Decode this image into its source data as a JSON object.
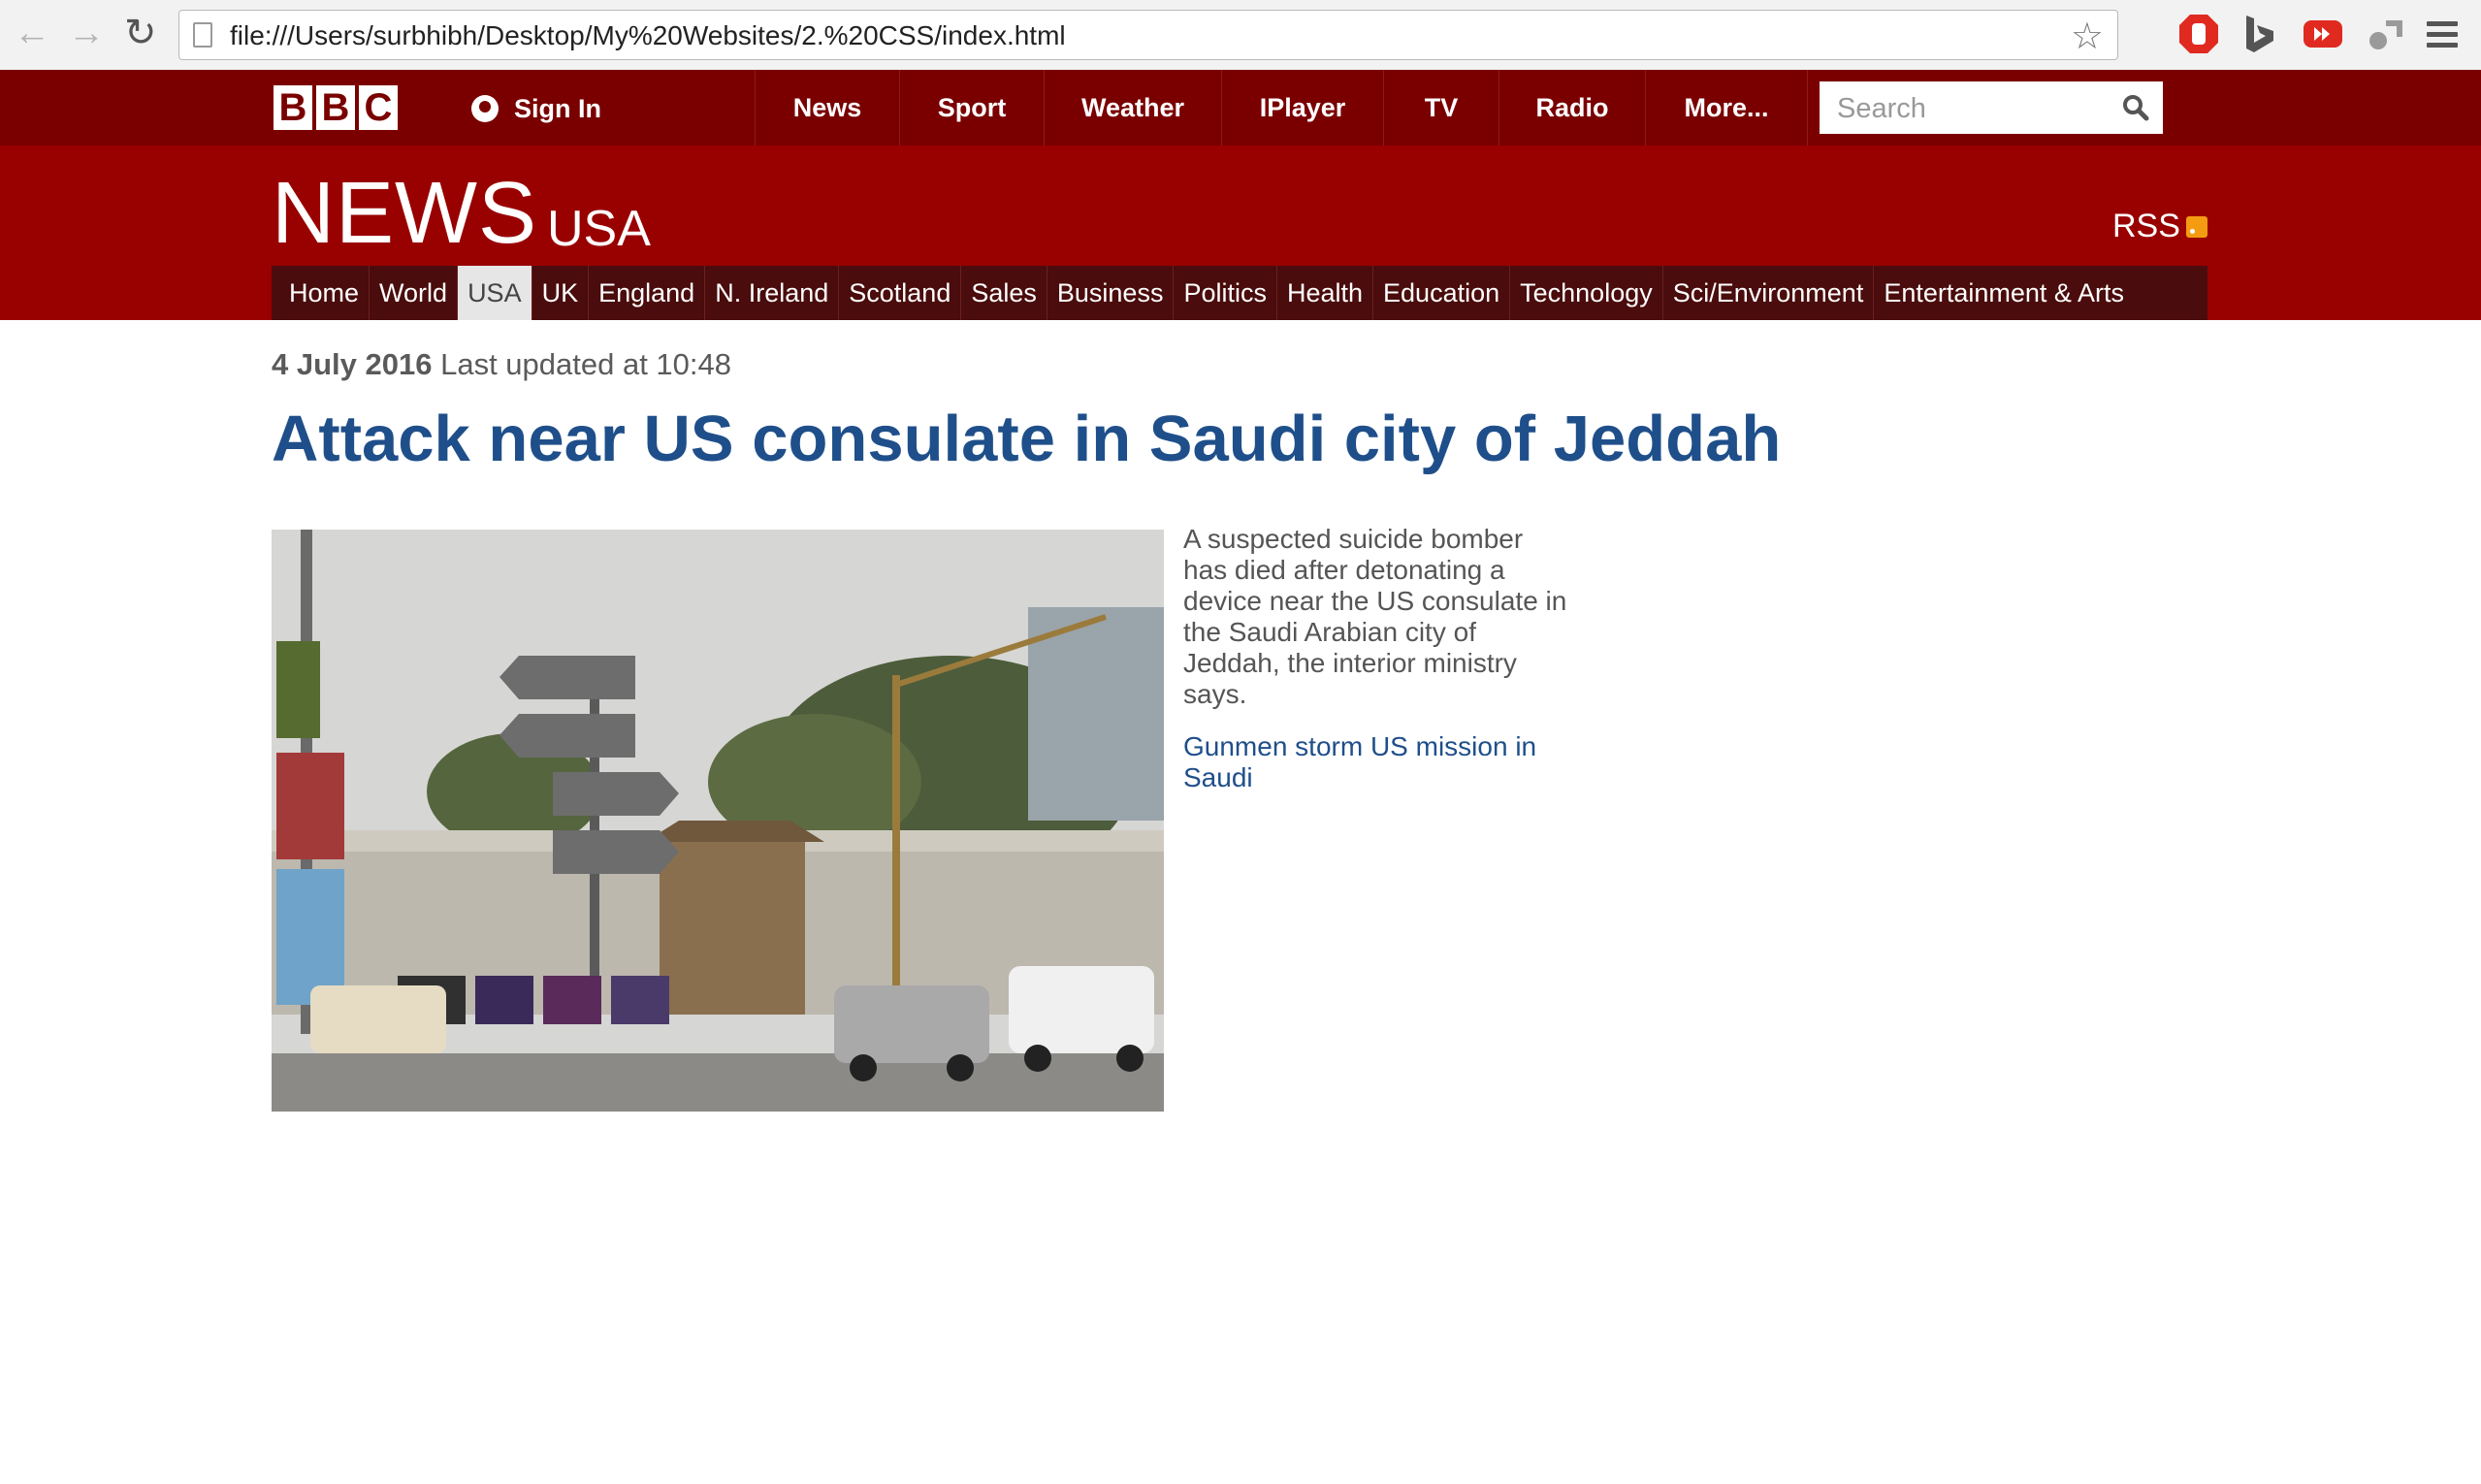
{
  "browser": {
    "url": "file:///Users/surbhibh/Desktop/My%20Websites/2.%20CSS/index.html",
    "icons": [
      "back-arrow-icon",
      "forward-arrow-icon",
      "reload-icon",
      "page-icon",
      "star-icon",
      "adblock-icon",
      "bing-icon",
      "youtube-icon",
      "extension-icon",
      "menu-icon"
    ]
  },
  "topbar": {
    "logo_letters": [
      "B",
      "B",
      "C"
    ],
    "sign_in": "Sign In",
    "nav": [
      "News",
      "Sport",
      "Weather",
      "IPlayer",
      "TV",
      "Radio",
      "More..."
    ],
    "search_placeholder": "Search"
  },
  "header": {
    "title": "NEWS",
    "subtitle": "USA",
    "rss": "RSS"
  },
  "subnav": {
    "items": [
      "Home",
      "World",
      "USA",
      "UK",
      "England",
      "N. Ireland",
      "Scotland",
      "Sales",
      "Business",
      "Politics",
      "Health",
      "Education",
      "Technology",
      "Sci/Environment",
      "Entertainment & Arts"
    ],
    "active": "USA"
  },
  "article": {
    "date": "4 July 2016",
    "updated": "Last updated at 10:48",
    "headline": "Attack near US consulate in Saudi city of Jeddah",
    "summary": "A suspected suicide bomber has died after detonating a device near the US consulate in the Saudi Arabian city of Jeddah, the interior ministry says.",
    "related_link": "Gunmen storm US mission in Saudi"
  },
  "colors": {
    "topbar": "#7a0000",
    "header": "#990000",
    "subnav": "#4a0c0c",
    "headline": "#1f4f8a"
  }
}
